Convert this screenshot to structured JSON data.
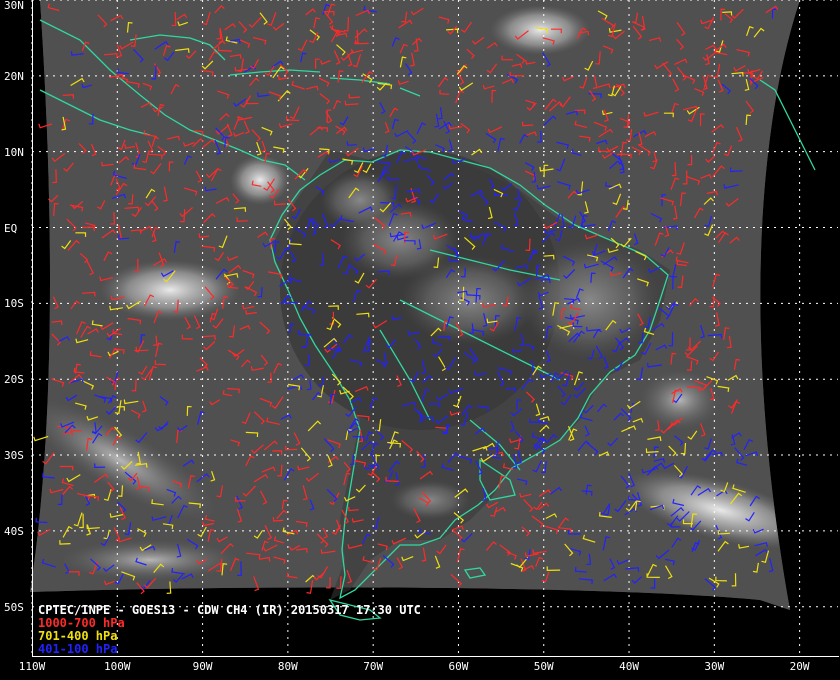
{
  "product": {
    "title": "CPTEC/INPE - GOES13 - CDW CH4 (IR) 20150317 17:30 UTC"
  },
  "legend": [
    {
      "label": "1000-700 hPa",
      "color": "#ff2a2a"
    },
    {
      "label": "701-400 hPa",
      "color": "#f0e010"
    },
    {
      "label": "401-100 hPa",
      "color": "#2222ff"
    }
  ],
  "colors": {
    "coastline": "#30d8a0",
    "grid": "#ffffff",
    "background": "#000000"
  },
  "latitude_labels": [
    {
      "text": "30N",
      "lat": 30
    },
    {
      "text": "20N",
      "lat": 20
    },
    {
      "text": "10N",
      "lat": 10
    },
    {
      "text": "EQ",
      "lat": 0
    },
    {
      "text": "10S",
      "lat": -10
    },
    {
      "text": "20S",
      "lat": -20
    },
    {
      "text": "30S",
      "lat": -30
    },
    {
      "text": "40S",
      "lat": -40
    },
    {
      "text": "50S",
      "lat": -50
    }
  ],
  "longitude_labels": [
    {
      "text": "110W",
      "lon": -110
    },
    {
      "text": "100W",
      "lon": -100
    },
    {
      "text": "90W",
      "lon": -90
    },
    {
      "text": "80W",
      "lon": -80
    },
    {
      "text": "70W",
      "lon": -70
    },
    {
      "text": "60W",
      "lon": -60
    },
    {
      "text": "50W",
      "lon": -50
    },
    {
      "text": "40W",
      "lon": -40
    },
    {
      "text": "30W",
      "lon": -30
    },
    {
      "text": "20W",
      "lon": -20
    }
  ],
  "extent": {
    "lon_min": -110,
    "lon_max": -15.5,
    "lat_max": 30,
    "lat_min": -56.5
  }
}
